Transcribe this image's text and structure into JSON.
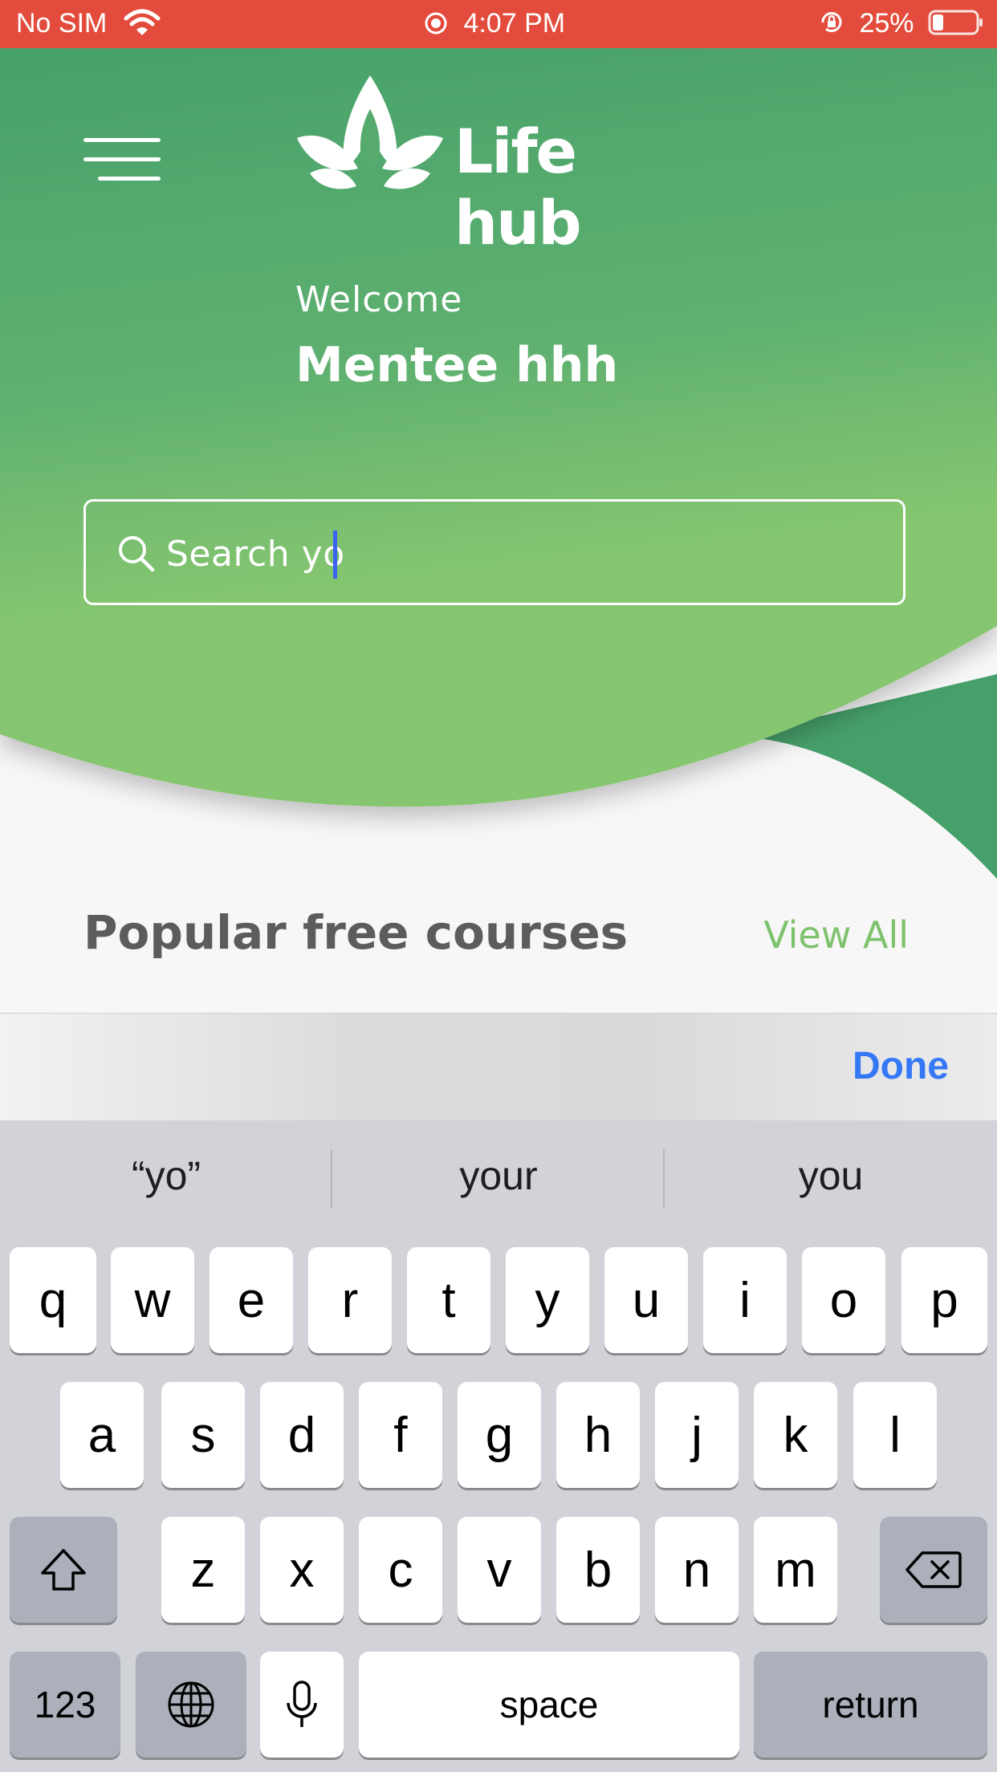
{
  "status_bar": {
    "carrier": "No SIM",
    "time": "4:07 PM",
    "battery_percent": "25%",
    "battery_level": 0.25,
    "color": "#e34c3d"
  },
  "header": {
    "brand": "Life hub",
    "welcome": "Welcome",
    "username": "Mentee hhh",
    "gradient_colors": [
      "#47a16b",
      "#86c670"
    ]
  },
  "search": {
    "value": "Search yo",
    "icon": "search-icon"
  },
  "section": {
    "title": "Popular free courses",
    "view_all": "View All"
  },
  "keyboard_accessory": {
    "done_label": "Done"
  },
  "keyboard": {
    "suggestions": [
      "“yo”",
      "your",
      "you"
    ],
    "row1": [
      "q",
      "w",
      "e",
      "r",
      "t",
      "y",
      "u",
      "i",
      "o",
      "p"
    ],
    "row2": [
      "a",
      "s",
      "d",
      "f",
      "g",
      "h",
      "j",
      "k",
      "l"
    ],
    "row3": [
      "z",
      "x",
      "c",
      "v",
      "b",
      "n",
      "m"
    ],
    "numbers_label": "123",
    "space_label": "space",
    "return_label": "return",
    "icons": {
      "shift": "shift-icon",
      "delete": "backspace-icon",
      "globe": "globe-icon",
      "mic": "microphone-icon"
    }
  }
}
